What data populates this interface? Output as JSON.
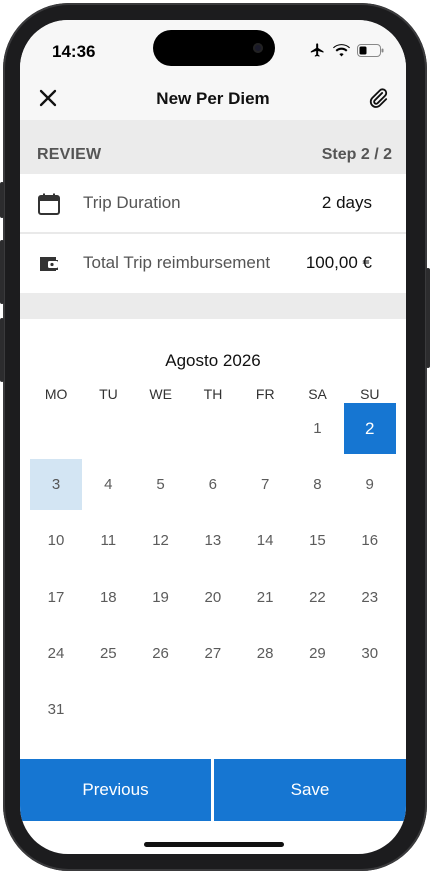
{
  "status_bar": {
    "time": "14:36"
  },
  "nav": {
    "title": "New Per Diem",
    "close_icon": "close-icon",
    "attach_icon": "paperclip-icon"
  },
  "step": {
    "label": "REVIEW",
    "counter": "Step 2 / 2"
  },
  "summary": [
    {
      "icon": "calendar-icon",
      "label": "Trip Duration",
      "value": "2 days"
    },
    {
      "icon": "wallet-icon",
      "label": "Total Trip reimbursement",
      "value": "100,00 €"
    }
  ],
  "calendar": {
    "month_label": "Agosto 2026",
    "weekdays": [
      "MO",
      "TU",
      "WE",
      "TH",
      "FR",
      "SA",
      "SU"
    ],
    "weeks": [
      [
        "",
        "",
        "",
        "",
        "",
        "1",
        "2"
      ],
      [
        "3",
        "4",
        "5",
        "6",
        "7",
        "8",
        "9"
      ],
      [
        "10",
        "11",
        "12",
        "13",
        "14",
        "15",
        "16"
      ],
      [
        "17",
        "18",
        "19",
        "20",
        "21",
        "22",
        "23"
      ],
      [
        "24",
        "25",
        "26",
        "27",
        "28",
        "29",
        "30"
      ],
      [
        "31",
        "",
        "",
        "",
        "",
        "",
        ""
      ]
    ],
    "selected_day": "2",
    "range_day": "3"
  },
  "footer": {
    "previous_label": "Previous",
    "save_label": "Save"
  },
  "colors": {
    "accent": "#1676d2",
    "range_highlight": "#d3e5f3",
    "band": "#ebebeb"
  }
}
